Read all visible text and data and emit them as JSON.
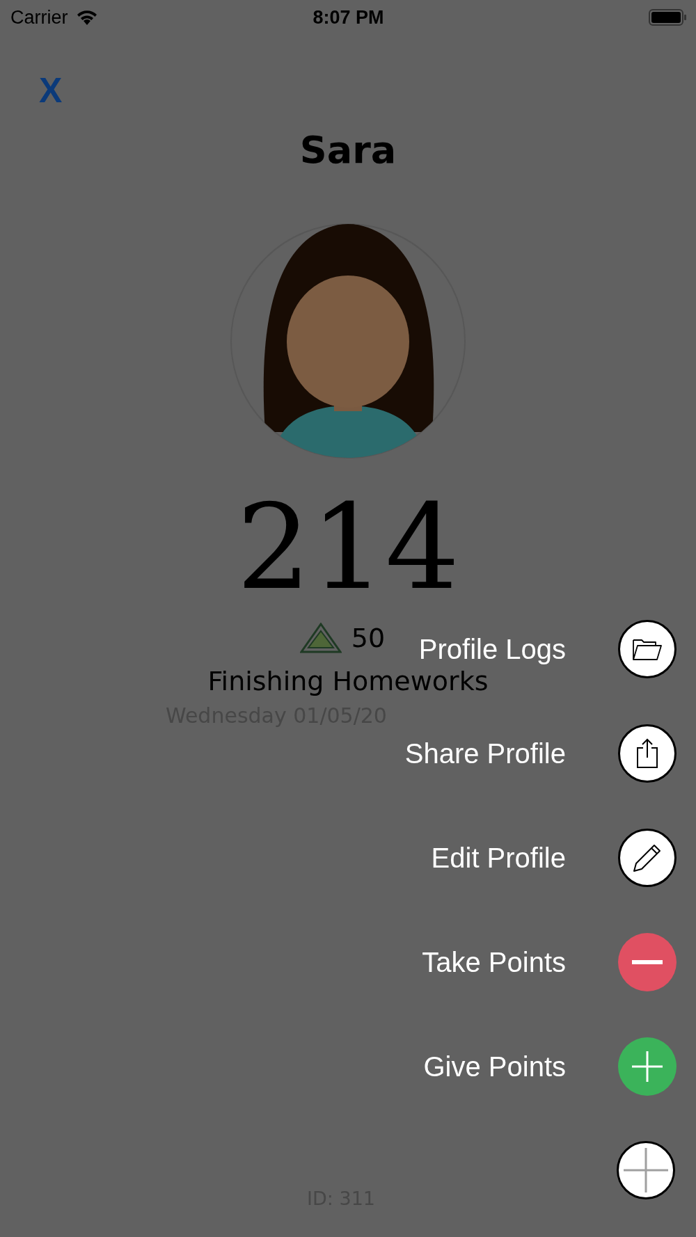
{
  "status_bar": {
    "carrier": "Carrier",
    "time": "8:07 PM"
  },
  "close_button": {
    "label": "X"
  },
  "profile": {
    "name": "Sara",
    "points": "214",
    "level_points": "50",
    "task": "Finishing Homeworks",
    "date": "Wednesday 01/05/20",
    "id": "ID: 311"
  },
  "fab": {
    "expanded": true
  },
  "menu": [
    {
      "label": "Profile Logs",
      "kind": "folder",
      "color": "#ffffff"
    },
    {
      "label": "Share Profile",
      "kind": "share",
      "color": "#ffffff"
    },
    {
      "label": "Edit Profile",
      "kind": "pencil",
      "color": "#ffffff"
    },
    {
      "label": "Take Points",
      "kind": "minus",
      "color": "#e05062"
    },
    {
      "label": "Give Points",
      "kind": "plus",
      "color": "#3bb35a"
    }
  ]
}
